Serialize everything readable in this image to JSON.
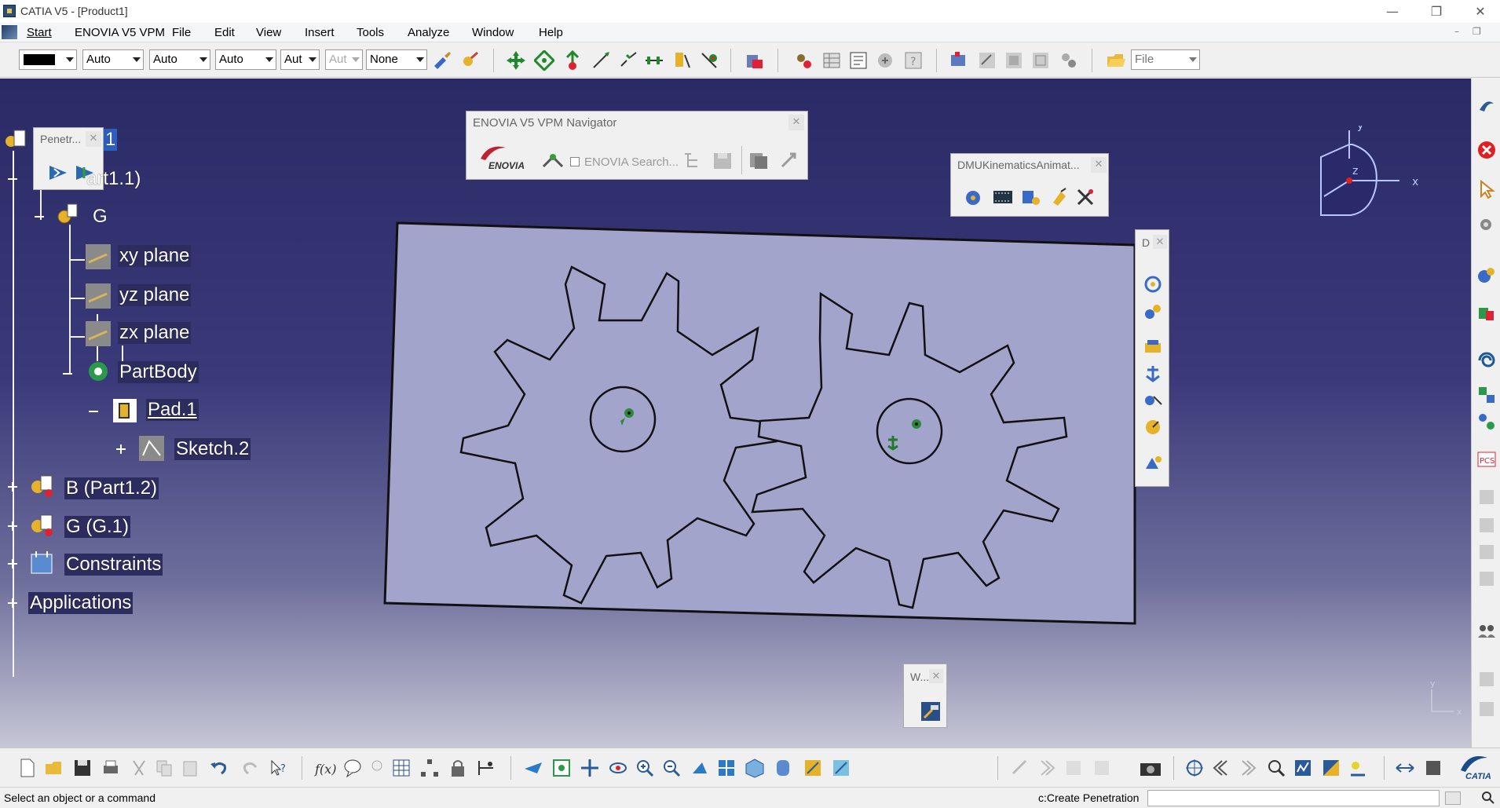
{
  "window": {
    "title": "CATIA V5 - [Product1]",
    "minimize": "—",
    "maximize": "❐",
    "close": "✕"
  },
  "menu": {
    "items": [
      "Start",
      "ENOVIA V5 VPM",
      "File",
      "Edit",
      "View",
      "Insert",
      "Tools",
      "Analyze",
      "Window",
      "Help"
    ],
    "mdi_minimize": "–",
    "mdi_restore": "❐"
  },
  "toolbar": {
    "color_combo": "",
    "transparency_combo": "Auto",
    "linetype_combo": "Auto",
    "thickness_combo": "Auto",
    "point_combo": "Aut",
    "layer_combo_disabled": "Aut",
    "render_combo": "None",
    "file_combo": "File"
  },
  "tree": {
    "root_label": "1",
    "penetration_title": "Penetr...",
    "part_label": "art1.1)",
    "g_label": "G",
    "xy_plane": "xy plane",
    "yz_plane": "yz plane",
    "zx_plane": "zx plane",
    "partbody": "PartBody",
    "pad": "Pad.1",
    "sketch": "Sketch.2",
    "part_b": "B (Part1.2)",
    "part_g": "G (G.1)",
    "constraints": "Constraints",
    "applications": "Applications"
  },
  "floating": {
    "enovia_title": "ENOVIA V5 VPM Navigator",
    "enovia_search": "ENOVIA Search...",
    "enovia_logo": "ENOVIA",
    "dmu_title": "DMUKinematicsAnimat...",
    "d_title": "D",
    "w_title": "W..."
  },
  "compass": {
    "x": "x",
    "y": "y",
    "z": "z"
  },
  "status": {
    "message": "Select an object or a command",
    "command_label": "c:Create Penetration",
    "command_value": ""
  },
  "brand": {
    "catia_mark": "CATIA"
  }
}
